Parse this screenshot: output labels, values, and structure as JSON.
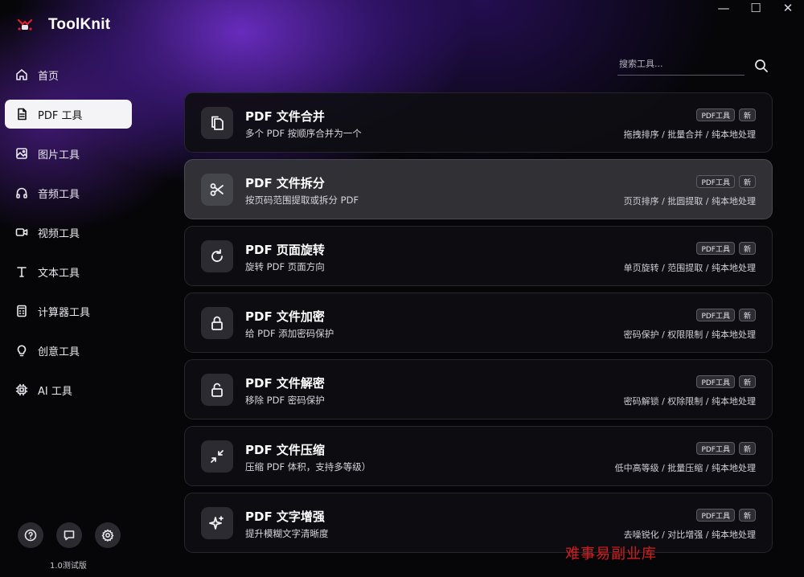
{
  "app": {
    "name": "ToolKnit"
  },
  "window_controls": {
    "minimize": "—",
    "maximize": "☐",
    "close": "✕"
  },
  "sidebar": {
    "items": [
      {
        "label": "首页",
        "icon": "home-icon",
        "active": false
      },
      {
        "label": "PDF 工具",
        "icon": "file-icon",
        "active": true
      },
      {
        "label": "图片工具",
        "icon": "image-icon",
        "active": false
      },
      {
        "label": "音频工具",
        "icon": "headphones-icon",
        "active": false
      },
      {
        "label": "视频工具",
        "icon": "video-icon",
        "active": false
      },
      {
        "label": "文本工具",
        "icon": "text-icon",
        "active": false
      },
      {
        "label": "计算器工具",
        "icon": "calculator-icon",
        "active": false
      },
      {
        "label": "创意工具",
        "icon": "lightbulb-icon",
        "active": false
      },
      {
        "label": "AI 工具",
        "icon": "chip-icon",
        "active": false
      }
    ],
    "bottom_buttons": [
      "help-icon",
      "feedback-icon",
      "settings-icon"
    ],
    "version": "1.0测试版"
  },
  "search": {
    "placeholder": "搜索工具..."
  },
  "tools": [
    {
      "title": "PDF 文件合并",
      "desc": "多个 PDF 按顺序合并为一个",
      "tag": "PDF工具",
      "badge": "新",
      "meta": "拖拽排序 / 批量合并 / 纯本地处理",
      "icon": "copy-icon",
      "highlight": false
    },
    {
      "title": "PDF 文件拆分",
      "desc": "按页码范围提取或拆分 PDF",
      "tag": "PDF工具",
      "badge": "新",
      "meta": "页页排序 / 批圆提取 / 纯本地处理",
      "icon": "scissors-icon",
      "highlight": true
    },
    {
      "title": "PDF 页面旋转",
      "desc": "旋转 PDF 页面方向",
      "tag": "PDF工具",
      "badge": "新",
      "meta": "单页旋转 / 范围提取 / 纯本地处理",
      "icon": "rotate-icon",
      "highlight": false
    },
    {
      "title": "PDF 文件加密",
      "desc": "给 PDF 添加密码保护",
      "tag": "PDF工具",
      "badge": "新",
      "meta": "密码保护 / 权限限制 / 纯本地处理",
      "icon": "lock-icon",
      "highlight": false
    },
    {
      "title": "PDF 文件解密",
      "desc": "移除 PDF 密码保护",
      "tag": "PDF工具",
      "badge": "新",
      "meta": "密码解锁 / 权除限制 / 纯本地处理",
      "icon": "unlock-icon",
      "highlight": false
    },
    {
      "title": "PDF 文件压缩",
      "desc": "压缩 PDF 体积，支持多等级）",
      "tag": "PDF工具",
      "badge": "新",
      "meta": "低中高等级 / 批量压缩 / 纯本地处理",
      "icon": "compress-icon",
      "highlight": false
    },
    {
      "title": "PDF 文字增强",
      "desc": "提升模糊文字清晰度",
      "tag": "PDF工具",
      "badge": "新",
      "meta": "去噪锐化 / 对比增强 / 纯本地处理",
      "icon": "sparkle-icon",
      "highlight": false
    }
  ],
  "watermark": "难事易副业库"
}
